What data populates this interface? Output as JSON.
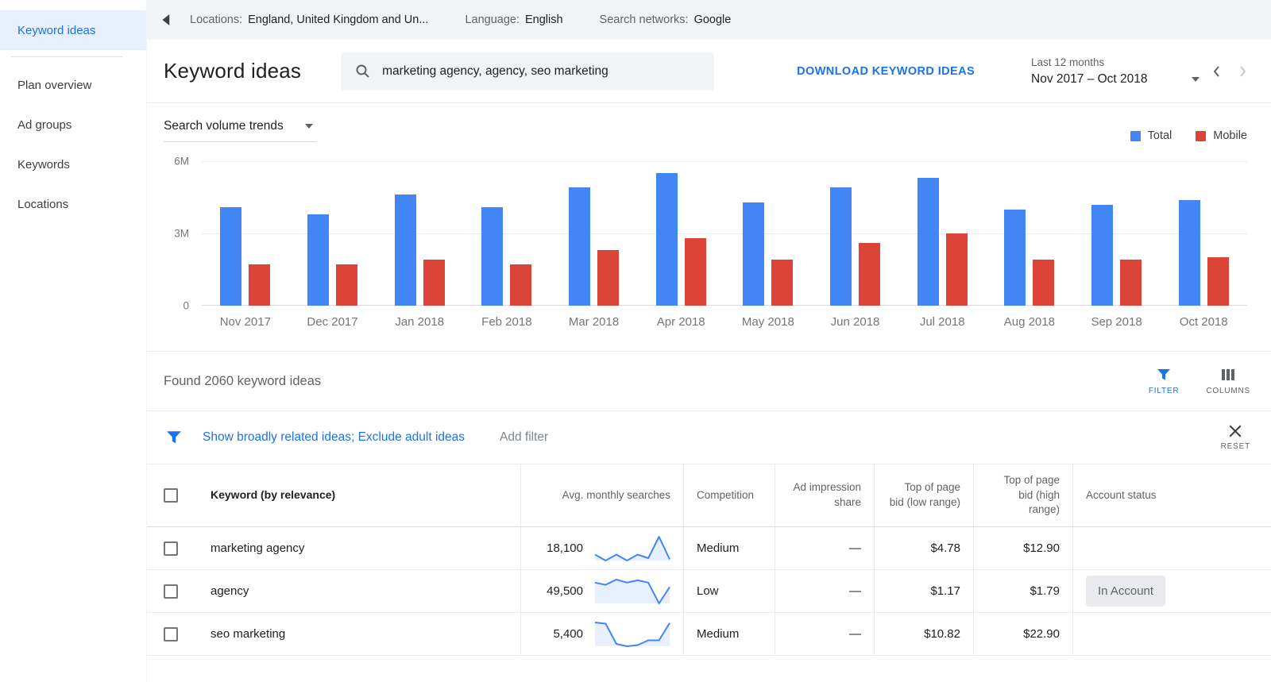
{
  "sidebar": {
    "items": [
      {
        "label": "Keyword ideas"
      },
      {
        "label": "Plan overview"
      },
      {
        "label": "Ad groups"
      },
      {
        "label": "Keywords"
      },
      {
        "label": "Locations"
      }
    ]
  },
  "settings_bar": {
    "locations": {
      "label": "Locations:",
      "value": "England, United Kingdom and Un..."
    },
    "language": {
      "label": "Language:",
      "value": "English"
    },
    "networks": {
      "label": "Search networks:",
      "value": "Google"
    }
  },
  "header": {
    "title": "Keyword ideas",
    "search_value": "marketing agency, agency, seo marketing",
    "download_label": "DOWNLOAD KEYWORD IDEAS",
    "date_range_caption": "Last 12 months",
    "date_range_value": "Nov 2017 – Oct 2018"
  },
  "chart": {
    "dropdown_label": "Search volume trends"
  },
  "chart_data": {
    "type": "bar",
    "title": "Search volume trends",
    "categories": [
      "Nov 2017",
      "Dec 2017",
      "Jan 2018",
      "Feb 2018",
      "Mar 2018",
      "Apr 2018",
      "May 2018",
      "Jun 2018",
      "Jul 2018",
      "Aug 2018",
      "Sep 2018",
      "Oct 2018"
    ],
    "series": [
      {
        "name": "Total",
        "color": "#4285F4",
        "values": [
          4.1,
          3.8,
          4.6,
          4.1,
          4.9,
          5.5,
          4.3,
          4.9,
          5.3,
          4.0,
          4.2,
          4.4
        ]
      },
      {
        "name": "Mobile",
        "color": "#DB4437",
        "values": [
          1.7,
          1.7,
          1.9,
          1.7,
          2.3,
          2.8,
          1.9,
          2.6,
          3.0,
          1.9,
          1.9,
          2.0
        ]
      }
    ],
    "unit": "M searches per month",
    "ylim": [
      0,
      6
    ],
    "yticks": [
      "0",
      "3M",
      "6M"
    ],
    "legend_position": "top-right",
    "grid": true
  },
  "results": {
    "found_text": "Found 2060 keyword ideas",
    "filter_label": "FILTER",
    "columns_label": "COLUMNS"
  },
  "filter_bar": {
    "active_filters": "Show broadly related ideas; Exclude adult ideas",
    "add_filter_label": "Add filter",
    "reset_label": "RESET"
  },
  "table": {
    "headers": {
      "keyword": "Keyword (by relevance)",
      "searches": "Avg. monthly searches",
      "competition": "Competition",
      "impression": "Ad impression share",
      "bid_low": "Top of page bid (low range)",
      "bid_high": "Top of page bid (high range)",
      "status": "Account status"
    },
    "rows": [
      {
        "keyword": "marketing agency",
        "searches": "18,100",
        "spark": [
          3,
          2,
          3,
          2,
          3,
          2.4,
          6,
          2.2
        ],
        "competition": "Medium",
        "impression": "—",
        "bid_low": "$4.78",
        "bid_high": "$12.90",
        "status": ""
      },
      {
        "keyword": "agency",
        "searches": "49,500",
        "spark": [
          5,
          4.7,
          5.4,
          5,
          5.3,
          5,
          2.2,
          4.4
        ],
        "competition": "Low",
        "impression": "—",
        "bid_low": "$1.17",
        "bid_high": "$1.79",
        "status": "In Account"
      },
      {
        "keyword": "seo marketing",
        "searches": "5,400",
        "spark": [
          6,
          5.8,
          2.4,
          2,
          2.2,
          3,
          3,
          5.9
        ],
        "competition": "Medium",
        "impression": "—",
        "bid_low": "$10.82",
        "bid_high": "$22.90",
        "status": ""
      }
    ]
  }
}
